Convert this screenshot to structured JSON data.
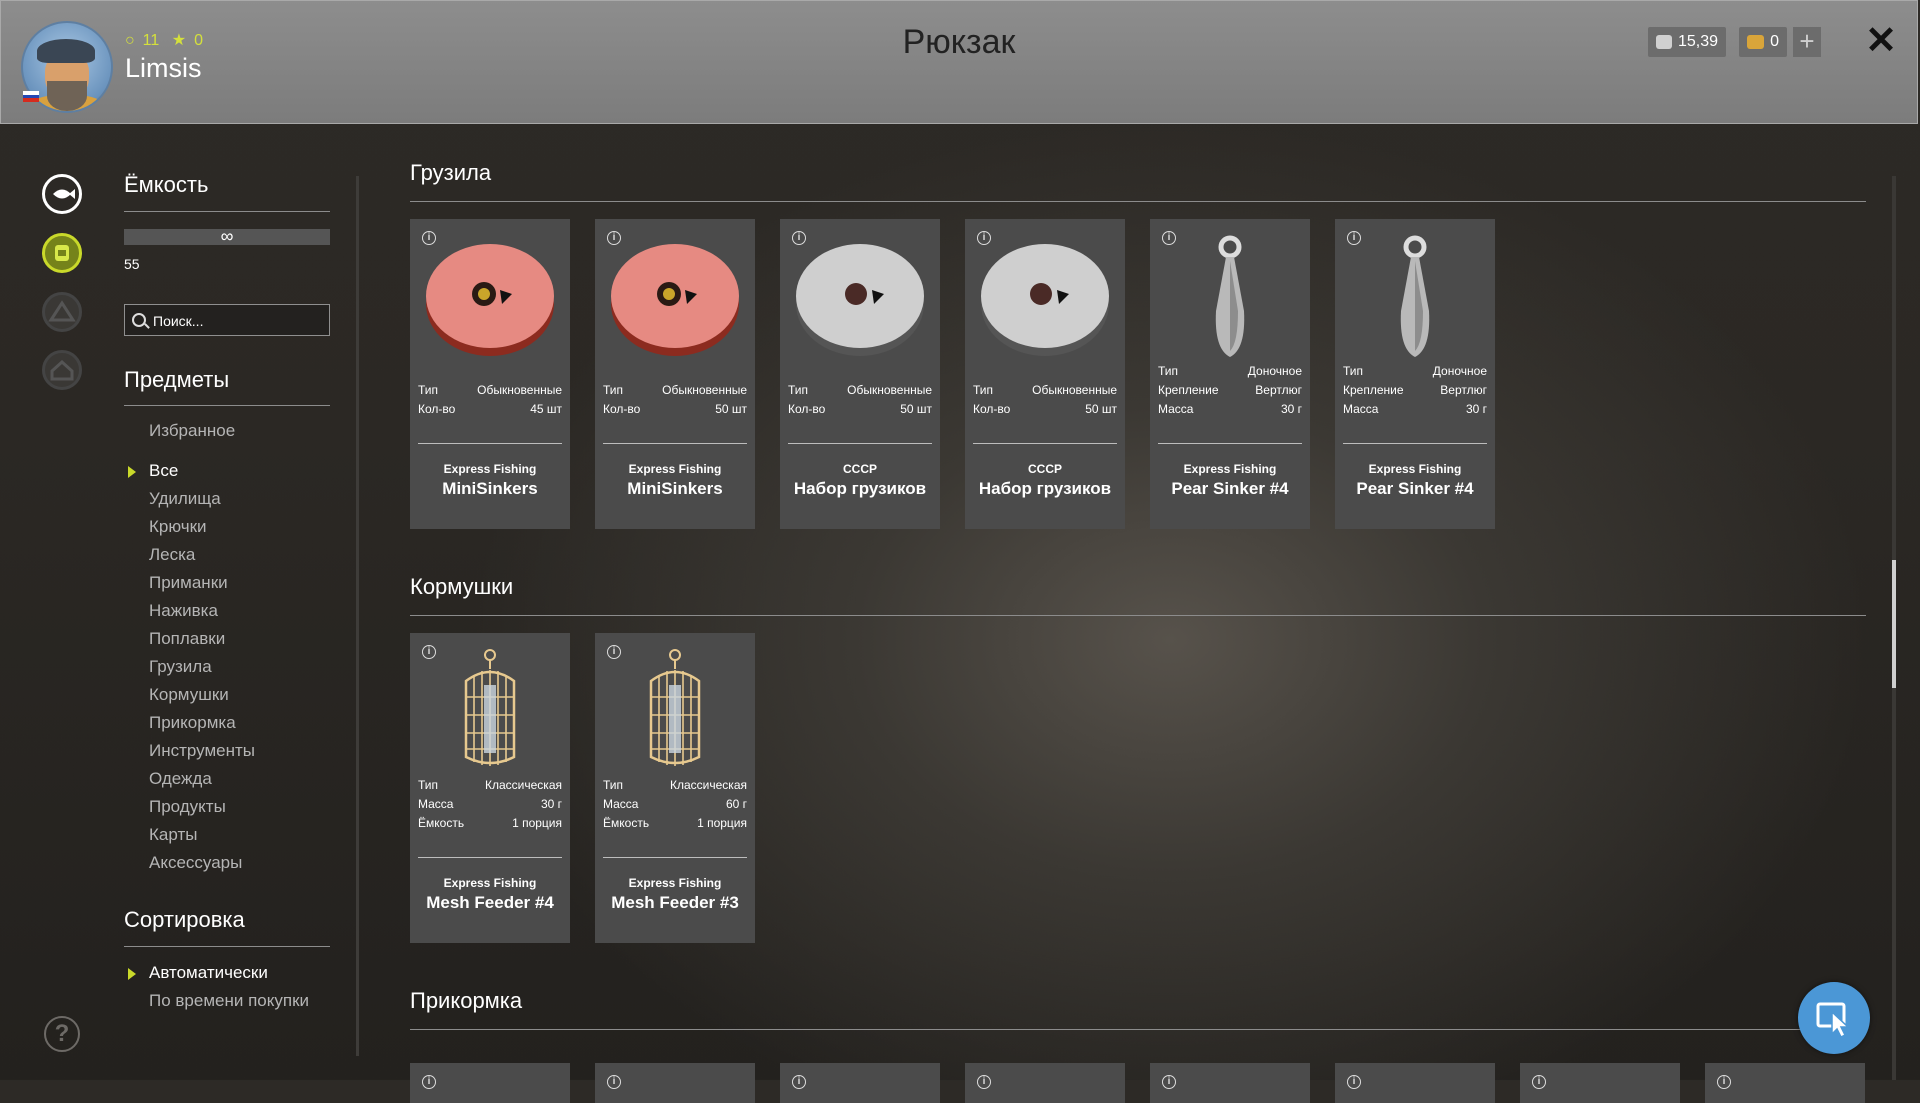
{
  "header": {
    "title": "Рюкзак",
    "username": "Limsis",
    "level": "11",
    "stars": "0",
    "silver": "15,39",
    "gold": "0",
    "plus": "+",
    "close": "✕"
  },
  "sidebar": {
    "capacity_title": "Ёмкость",
    "capacity_symbol": "∞",
    "capacity_value": "55",
    "search_placeholder": "Поиск...",
    "items_title": "Предметы",
    "categories": [
      "Избранное",
      "Все",
      "Удилища",
      "Крючки",
      "Леска",
      "Приманки",
      "Наживка",
      "Поплавки",
      "Грузила",
      "Кормушки",
      "Прикормка",
      "Инструменты",
      "Одежда",
      "Продукты",
      "Карты",
      "Аксессуары"
    ],
    "selected_category": "Все",
    "sort_title": "Сортировка",
    "sort_options": [
      "Автоматически",
      "По времени покупки"
    ],
    "selected_sort": "Автоматически",
    "help": "?"
  },
  "sections": [
    {
      "title": "Грузила",
      "items": [
        {
          "props": [
            [
              "Тип",
              "Обыкновенные"
            ],
            [
              "Кол-во",
              "45 шт"
            ]
          ],
          "brand": "Express Fishing",
          "name": "MiniSinkers",
          "image": "red-sinker-box-icon"
        },
        {
          "props": [
            [
              "Тип",
              "Обыкновенные"
            ],
            [
              "Кол-во",
              "50 шт"
            ]
          ],
          "brand": "Express Fishing",
          "name": "MiniSinkers",
          "image": "red-sinker-box-icon"
        },
        {
          "props": [
            [
              "Тип",
              "Обыкновенные"
            ],
            [
              "Кол-во",
              "50 шт"
            ]
          ],
          "brand": "СССР",
          "name": "Набор грузиков",
          "image": "grey-sinker-box-icon"
        },
        {
          "props": [
            [
              "Тип",
              "Обыкновенные"
            ],
            [
              "Кол-во",
              "50 шт"
            ]
          ],
          "brand": "СССР",
          "name": "Набор грузиков",
          "image": "grey-sinker-box-icon"
        },
        {
          "props": [
            [
              "Тип",
              "Доночное"
            ],
            [
              "Крепление",
              "Вертлюг"
            ],
            [
              "Масса",
              "30 г"
            ]
          ],
          "brand": "Express Fishing",
          "name": "Pear Sinker #4",
          "image": "pear-sinker-icon"
        },
        {
          "props": [
            [
              "Тип",
              "Доночное"
            ],
            [
              "Крепление",
              "Вертлюг"
            ],
            [
              "Масса",
              "30 г"
            ]
          ],
          "brand": "Express Fishing",
          "name": "Pear Sinker #4",
          "image": "pear-sinker-icon"
        }
      ]
    },
    {
      "title": "Кормушки",
      "items": [
        {
          "props": [
            [
              "Тип",
              "Классическая"
            ],
            [
              "Масса",
              "30 г"
            ],
            [
              "Ёмкость",
              "1 порция"
            ]
          ],
          "brand": "Express Fishing",
          "name": "Mesh Feeder #4",
          "image": "mesh-feeder-icon"
        },
        {
          "props": [
            [
              "Тип",
              "Классическая"
            ],
            [
              "Масса",
              "60 г"
            ],
            [
              "Ёмкость",
              "1 порция"
            ]
          ],
          "brand": "Express Fishing",
          "name": "Mesh Feeder #3",
          "image": "mesh-feeder-icon"
        }
      ]
    },
    {
      "title": "Прикормка",
      "partial_count": 8
    }
  ],
  "colors": {
    "accent": "#c9d92a",
    "card": "#4b4b4b",
    "header": "#858585",
    "fab": "#4b97d6"
  }
}
